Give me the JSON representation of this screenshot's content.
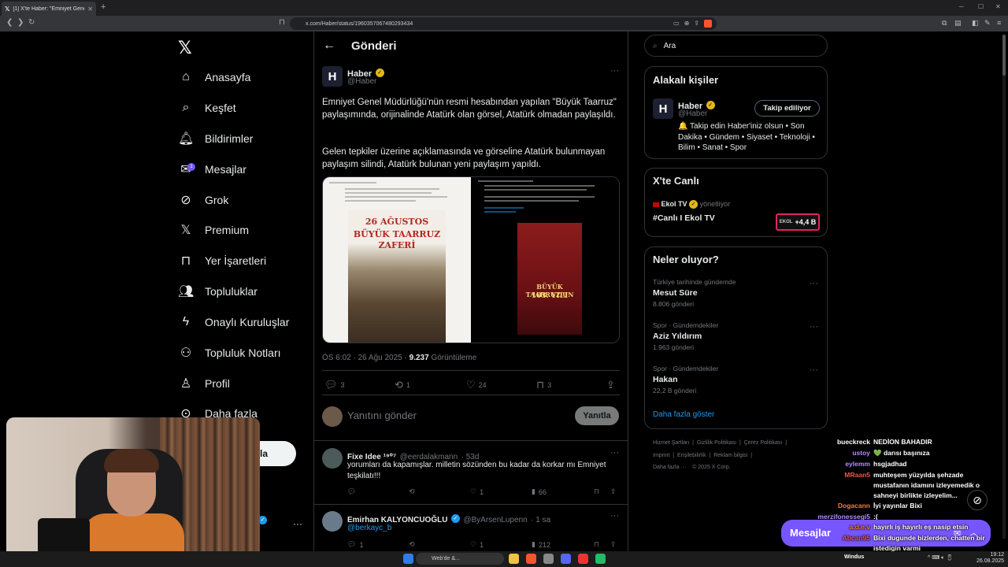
{
  "browser": {
    "tab_title": "[1] X'te Haber: \"Emniyet Genel Mü",
    "url": "x.com/Haber/status/1960357067480293434"
  },
  "nav": {
    "items": [
      {
        "label": "Anasayfa",
        "icon": "home-icon"
      },
      {
        "label": "Keşfet",
        "icon": "search-icon"
      },
      {
        "label": "Bildirimler",
        "icon": "bell-icon"
      },
      {
        "label": "Mesajlar",
        "icon": "mail-icon",
        "badge": "1"
      },
      {
        "label": "Grok",
        "icon": "grok-icon"
      },
      {
        "label": "Premium",
        "icon": "x-icon"
      },
      {
        "label": "Yer İşaretleri",
        "icon": "bookmark-icon"
      },
      {
        "label": "Topluluklar",
        "icon": "communities-icon"
      },
      {
        "label": "Onaylı Kuruluşlar",
        "icon": "lightning-icon"
      },
      {
        "label": "Topluluk Notları",
        "icon": "notes-icon"
      },
      {
        "label": "Profil",
        "icon": "person-icon"
      },
      {
        "label": "Daha fazla",
        "icon": "more-circle-icon"
      }
    ],
    "post_button_partial": "la"
  },
  "header": {
    "title": "Gönderi"
  },
  "post": {
    "author_name": "Haber",
    "author_handle": "@Haber",
    "avatar_letter": "H",
    "text_p1": "Emniyet Genel Müdürlüğü'nün resmi hesabından yapılan \"Büyük Taarruz\" paylaşımında, orijinalinde Atatürk olan görsel, Atatürk olmadan paylaşıldı.",
    "text_p2": "Gelen tepkiler üzerine açıklamasında ve görseline Atatürk bulunmayan paylaşım silindi, Atatürk bulunan yeni paylaşım yapıldı.",
    "image_left": {
      "date": "26 AĞUSTOS",
      "title1": "BÜYÜK TAARRUZ",
      "title2": "ZAFERİ"
    },
    "image_right": {
      "title1": "BÜYÜK TAARRUZ'UN",
      "title2": "103. YILI"
    },
    "time": "ÖS 6:02 · 26 Ağu 2025 · ",
    "views": "9.237",
    "views_label": " Görüntüleme",
    "replies": "3",
    "reposts": "1",
    "likes": "24",
    "bookmarks": "3"
  },
  "reply_box": {
    "placeholder": "Yanıtını gönder",
    "button": "Yanıtla"
  },
  "replies": [
    {
      "name": "Fixe Idee ¹⁹⁰⁷",
      "handle": "@eerdalakmann",
      "time": "· 53d",
      "text": "yorumları da kapamışlar. milletin sözünden bu kadar da korkar mı Emniyet teşkilatı!!!",
      "replies": "",
      "reposts": "",
      "likes": "1",
      "views": "66"
    },
    {
      "name": "Emirhan KALYONCUOĞLU",
      "handle": "@ByArsenLupenn",
      "time": "· 1 sa",
      "text": "@berkayc_b",
      "replies": "1",
      "reposts": "",
      "likes": "1",
      "views": "212"
    }
  ],
  "search": {
    "placeholder": "Ara"
  },
  "related": {
    "title": "Alakalı kişiler",
    "name": "Haber",
    "handle": "@Haber",
    "follow_label": "Takip ediliyor",
    "bio": "🔔 Takip edin Haber'iniz olsun • Son Dakika • Gündem • Siyaset • Teknoloji • Bilim • Sanat • Spor"
  },
  "live": {
    "title": "X'te Canlı",
    "host": "Ekol TV",
    "host_suffix": "yönetliyor",
    "stream_title": "#Canlı I Ekol TV",
    "badge_logo": "EKOL",
    "badge_count": "+4,4 B"
  },
  "trends": {
    "title": "Neler oluyor?",
    "items": [
      {
        "category": "Türkiye tarihinde gündemde",
        "name": "Mesut Süre",
        "count": "8.806 gönderi"
      },
      {
        "category": "Spor · Gündemdekiler",
        "name": "Aziz Yıldırım",
        "count": "1.963 gönderi"
      },
      {
        "category": "Spor · Gündemdekiler",
        "name": "Hakan",
        "count": "22,2 B gönderi"
      }
    ],
    "show_more": "Daha fazla göster"
  },
  "footer": {
    "row1": [
      "Hizmet Şartları",
      "Gizlilik Politikası",
      "Çerez Politikası"
    ],
    "row2": [
      "Imprint",
      "Erişilebilirlik",
      "Reklam bilgisi"
    ],
    "row3": [
      "Daha fazla ···",
      "© 2025 X Corp."
    ]
  },
  "chat": [
    {
      "user": "bueckreck",
      "msg": "NEDİON BAHADIR",
      "color": "#ffffff"
    },
    {
      "user": "ustoy",
      "msg": "💚 darısı başınıza",
      "color": "#b48cff"
    },
    {
      "user": "eylemm",
      "msg": "hsgjadhad",
      "color": "#b48cff"
    },
    {
      "user": "MRaan5",
      "msg": "muhteşem yüzyılda şehzade mustafanın idamını izleyemedik o sahneyi birlikte izleyelim...",
      "color": "#ff4d4d"
    },
    {
      "user": "Dogacann",
      "msg": "İyi yayınlar Bixi",
      "color": "#ff7a2a"
    },
    {
      "user": "merzifonessegi5",
      "msg": ":(",
      "color": "#b48cff"
    },
    {
      "user": "a.d.e.v",
      "msg": "hayırlı iş hayırlı eş nasip etsin",
      "color": "#ff7a2a"
    },
    {
      "user": "Abcan95",
      "msg": "Bixi dugunde bizlerden, chatten bir istedigin varmi",
      "color": "#ff4d4d"
    }
  ],
  "messages_bar": {
    "label": "Mesajlar"
  },
  "taskbar": {
    "search": "Web'de &...",
    "time": "19:12",
    "date": "26.08.2025",
    "app_label": "Windus"
  },
  "colors": {
    "accent": "#1d9bf0",
    "grok_purple": "#7856ff",
    "gold_check": "#e2b719"
  }
}
